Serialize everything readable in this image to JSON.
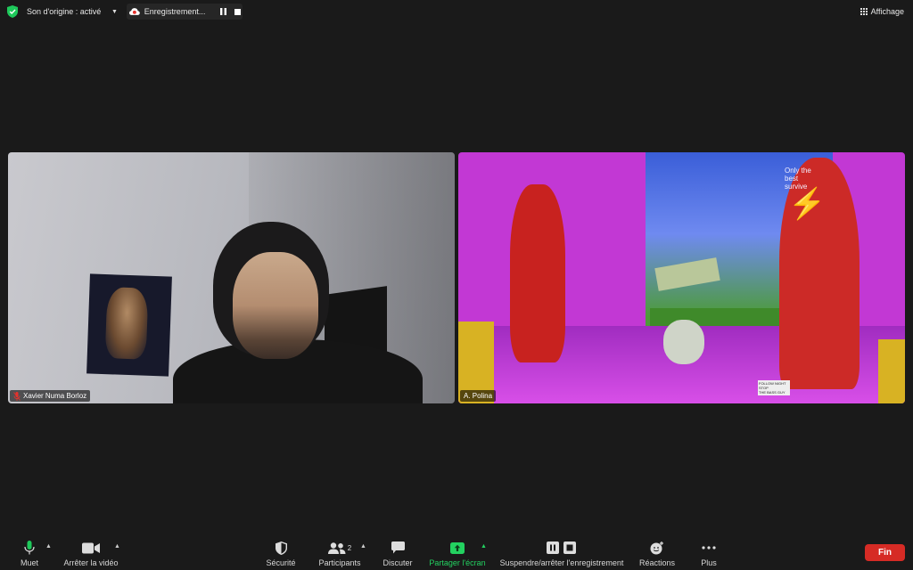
{
  "top_bar": {
    "original_sound_label": "Son d'origine : activé",
    "recording_label": "Enregistrement...",
    "view_label": "Affichage"
  },
  "participants": [
    {
      "name": "Xavier Numa Borloz",
      "mic_muted": true
    },
    {
      "name": "A. Polina",
      "mic_muted": false
    }
  ],
  "video_overlay_text": {
    "slogan": "Only the\nbest survive",
    "small_print": "FOLLOW NIGHT STOP\nTHE BASS GUY"
  },
  "toolbar": {
    "mute_label": "Muet",
    "stop_video_label": "Arrêter la vidéo",
    "security_label": "Sécurité",
    "participants_label": "Participants",
    "participants_count": "2",
    "chat_label": "Discuter",
    "share_screen_label": "Partager l'écran",
    "recording_control_label": "Suspendre/arrêter l'enregistrement",
    "reactions_label": "Réactions",
    "more_label": "Plus",
    "end_label": "Fin"
  },
  "colors": {
    "background": "#1a1a1a",
    "share_green": "#23d160",
    "end_red": "#d62b25",
    "security_green": "#1ec95b"
  }
}
